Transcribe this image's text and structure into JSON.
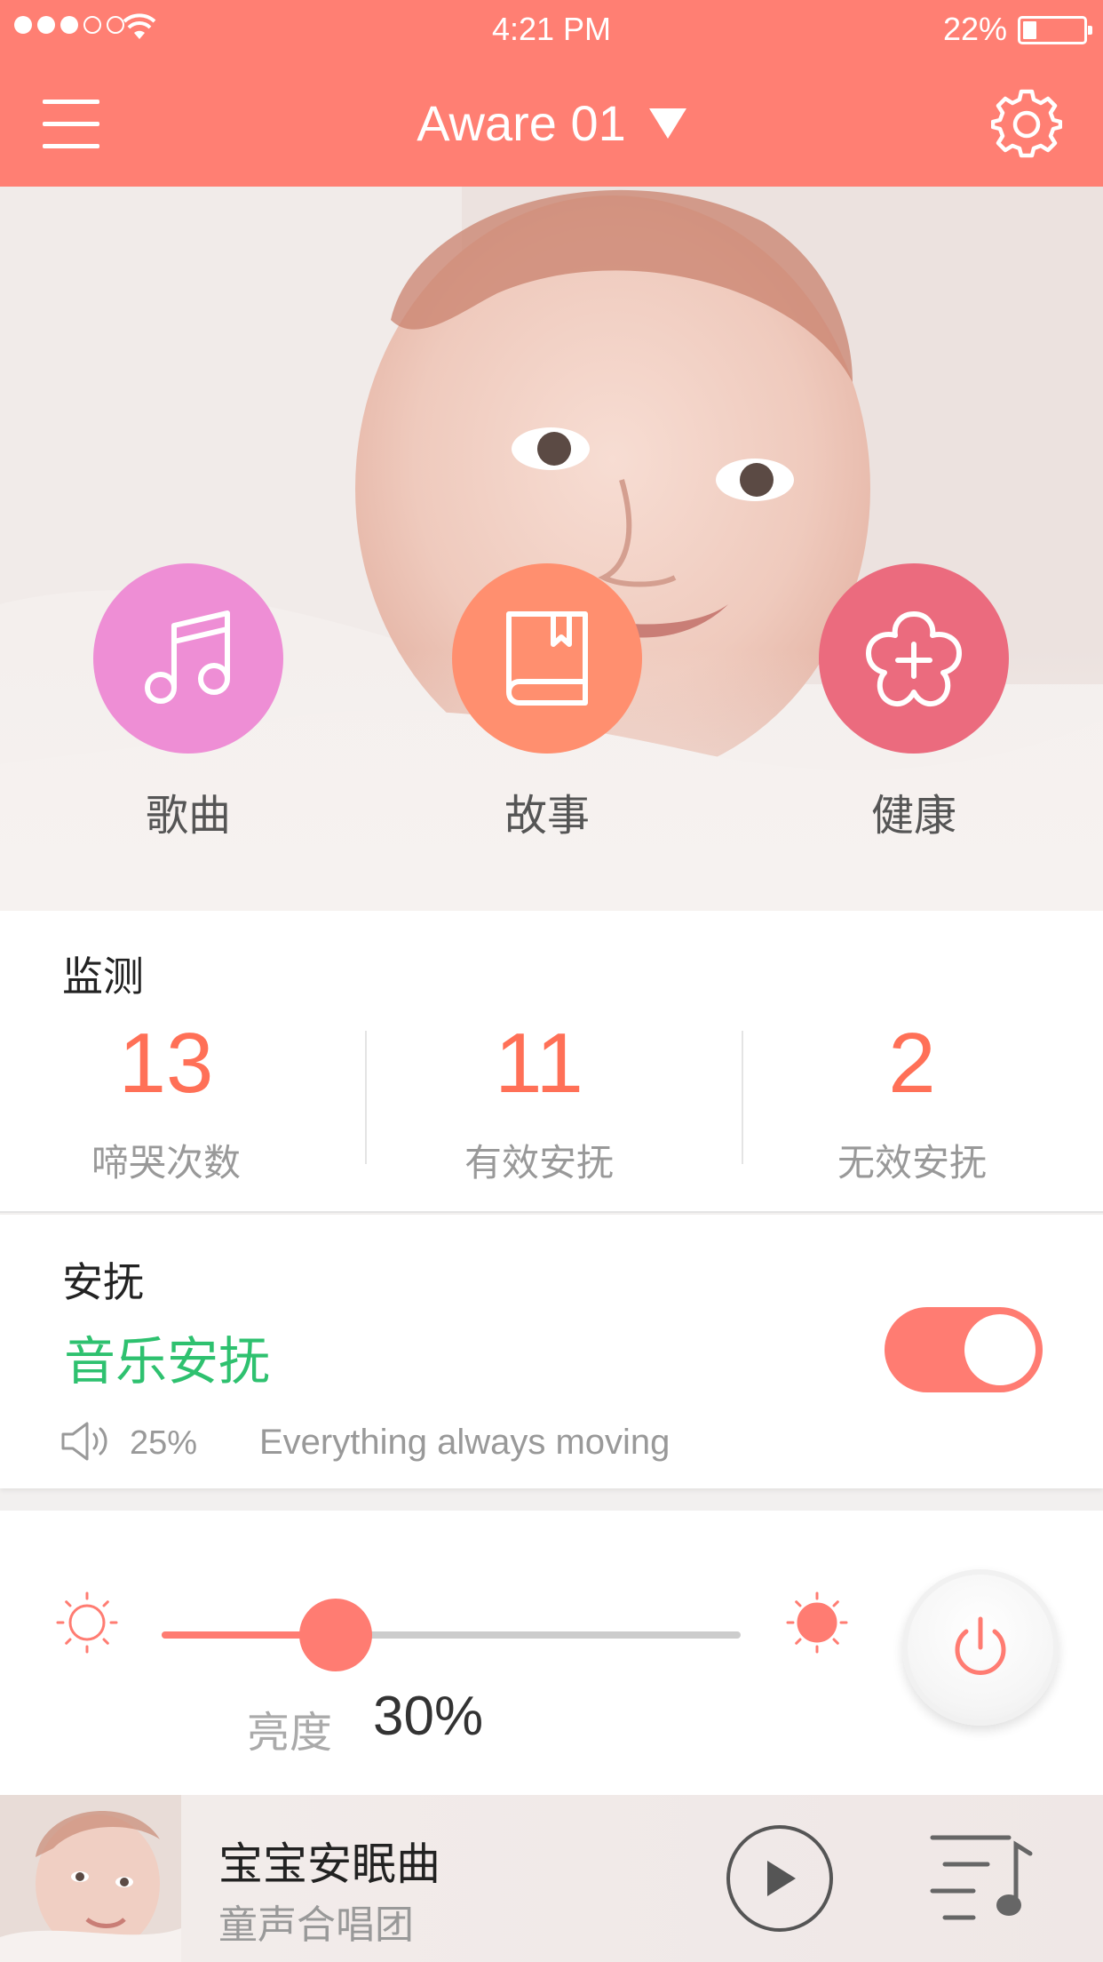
{
  "status_bar": {
    "time": "4:21 PM",
    "battery_percent": "22%",
    "battery_level": 0.22,
    "signal_bars_filled": 3,
    "signal_bars_total": 5
  },
  "nav": {
    "device_name": "Aware 01",
    "menu_icon": "hamburger-menu-icon",
    "dropdown_icon": "triangle-down-icon",
    "settings_icon": "gear-icon"
  },
  "hero": {
    "actions": [
      {
        "label": "歌曲",
        "icon": "music-note-icon",
        "color": "#ee8ed5"
      },
      {
        "label": "故事",
        "icon": "book-icon",
        "color": "#ff8f6f"
      },
      {
        "label": "健康",
        "icon": "health-plus-icon",
        "color": "#eb6b7e"
      }
    ]
  },
  "monitor": {
    "title": "监测",
    "stats": [
      {
        "value": "13",
        "label": "啼哭次数"
      },
      {
        "value": "11",
        "label": "有效安抚"
      },
      {
        "value": "2",
        "label": "无效安抚"
      }
    ]
  },
  "soothe": {
    "title": "安抚",
    "mode": "音乐安抚",
    "enabled": true,
    "volume": "25%",
    "track": "Everything always moving"
  },
  "brightness": {
    "label": "亮度",
    "value": "30%",
    "level": 0.3
  },
  "player": {
    "title": "宝宝安眠曲",
    "artist": "童声合唱团",
    "play_icon": "play-icon",
    "playlist_icon": "playlist-icon"
  },
  "colors": {
    "accent": "#ff7f73",
    "stat_number": "#ff7057",
    "mode_green": "#2ec16f"
  }
}
